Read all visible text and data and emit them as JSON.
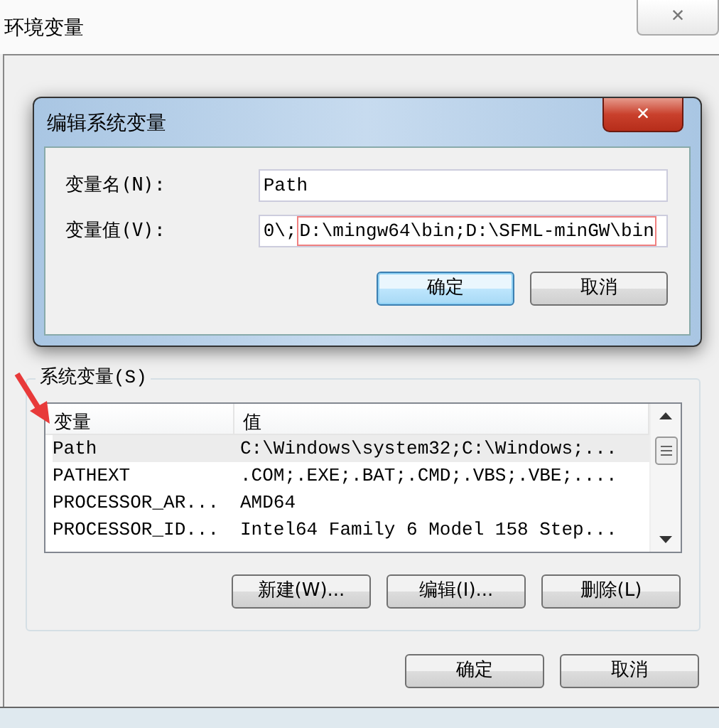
{
  "window": {
    "title": "环境变量",
    "close": "✕"
  },
  "dialog": {
    "title": "编辑系统变量",
    "close": "✕",
    "fields": [
      {
        "label": "变量名(N):",
        "value_parts": [
          {
            "text": "Path",
            "highlighted": false
          }
        ]
      },
      {
        "label": "变量值(V):",
        "value_parts": [
          {
            "text": "0\\;",
            "highlighted": false
          },
          {
            "text": "D:\\mingw64\\bin;D:\\SFML-minGW\\bin",
            "highlighted": true
          }
        ]
      }
    ],
    "buttons": [
      {
        "label": "确定",
        "default": true
      },
      {
        "label": "取消",
        "default": false
      }
    ]
  },
  "system_variables": {
    "title": "系统变量(S)",
    "columns": [
      "变量",
      "值"
    ],
    "rows": [
      {
        "cells": [
          "Path",
          "C:\\Windows\\system32;C:\\Windows;..."
        ],
        "selected": true
      },
      {
        "cells": [
          "PATHEXT",
          ".COM;.EXE;.BAT;.CMD;.VBS;.VBE;...."
        ],
        "selected": false
      },
      {
        "cells": [
          "PROCESSOR_AR...",
          "AMD64"
        ],
        "selected": false
      },
      {
        "cells": [
          "PROCESSOR_ID...",
          "Intel64 Family 6 Model 158 Step..."
        ],
        "selected": false
      }
    ],
    "buttons": [
      "新建(W)...",
      "编辑(I)...",
      "删除(L)"
    ]
  },
  "footer_buttons": [
    "确定",
    "取消"
  ]
}
